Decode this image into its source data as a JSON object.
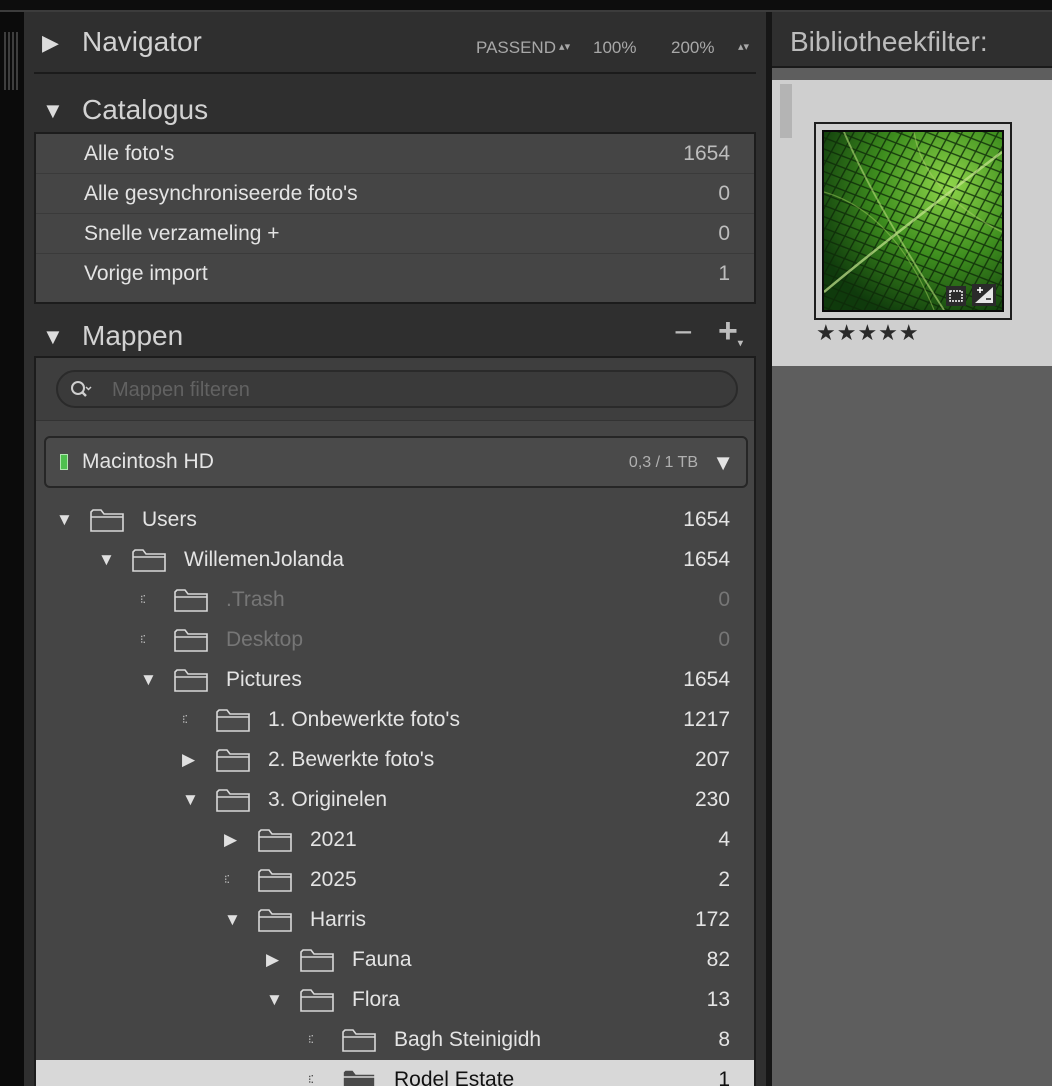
{
  "navigator": {
    "title": "Navigator",
    "zoom_fit": "PASSEND",
    "zoom_100": "100%",
    "zoom_200": "200%"
  },
  "catalog": {
    "title": "Catalogus",
    "items": [
      {
        "label": "Alle foto's",
        "count": "1654"
      },
      {
        "label": "Alle gesynchroniseerde foto's",
        "count": "0"
      },
      {
        "label": "Snelle verzameling  +",
        "count": "0"
      },
      {
        "label": "Vorige import",
        "count": "1"
      }
    ]
  },
  "folders": {
    "title": "Mappen",
    "remove_glyph": "−",
    "add_glyph": "+",
    "search_placeholder": "Mappen filteren",
    "search_value": "",
    "volume": {
      "name": "Macintosh HD",
      "size": "0,3 / 1 TB",
      "led_color": "#4ec04e"
    },
    "tree": [
      {
        "label": "Users",
        "count": "1654"
      },
      {
        "label": "WillemenJolanda",
        "count": "1654"
      },
      {
        "label": ".Trash",
        "count": "0"
      },
      {
        "label": "Desktop",
        "count": "0"
      },
      {
        "label": "Pictures",
        "count": "1654"
      },
      {
        "label": "1. Onbewerkte foto's",
        "count": "1217"
      },
      {
        "label": "2. Bewerkte foto's",
        "count": "207"
      },
      {
        "label": "3. Originelen",
        "count": "230"
      },
      {
        "label": "2021",
        "count": "4"
      },
      {
        "label": "2025",
        "count": "2"
      },
      {
        "label": "Harris",
        "count": "172"
      },
      {
        "label": "Fauna",
        "count": "82"
      },
      {
        "label": "Flora",
        "count": "13"
      },
      {
        "label": "Bagh Steinigidh",
        "count": "8"
      },
      {
        "label": "Rodel Estate",
        "count": "1"
      }
    ]
  },
  "library_filter": {
    "title": "Bibliotheekfilter:"
  },
  "thumbnail": {
    "rating": "★★★★★"
  },
  "colors": {
    "panel": "#2f2f2f",
    "content": "#454545",
    "selected_row": "#d8d8d8",
    "grid": "#cfcfcf"
  }
}
